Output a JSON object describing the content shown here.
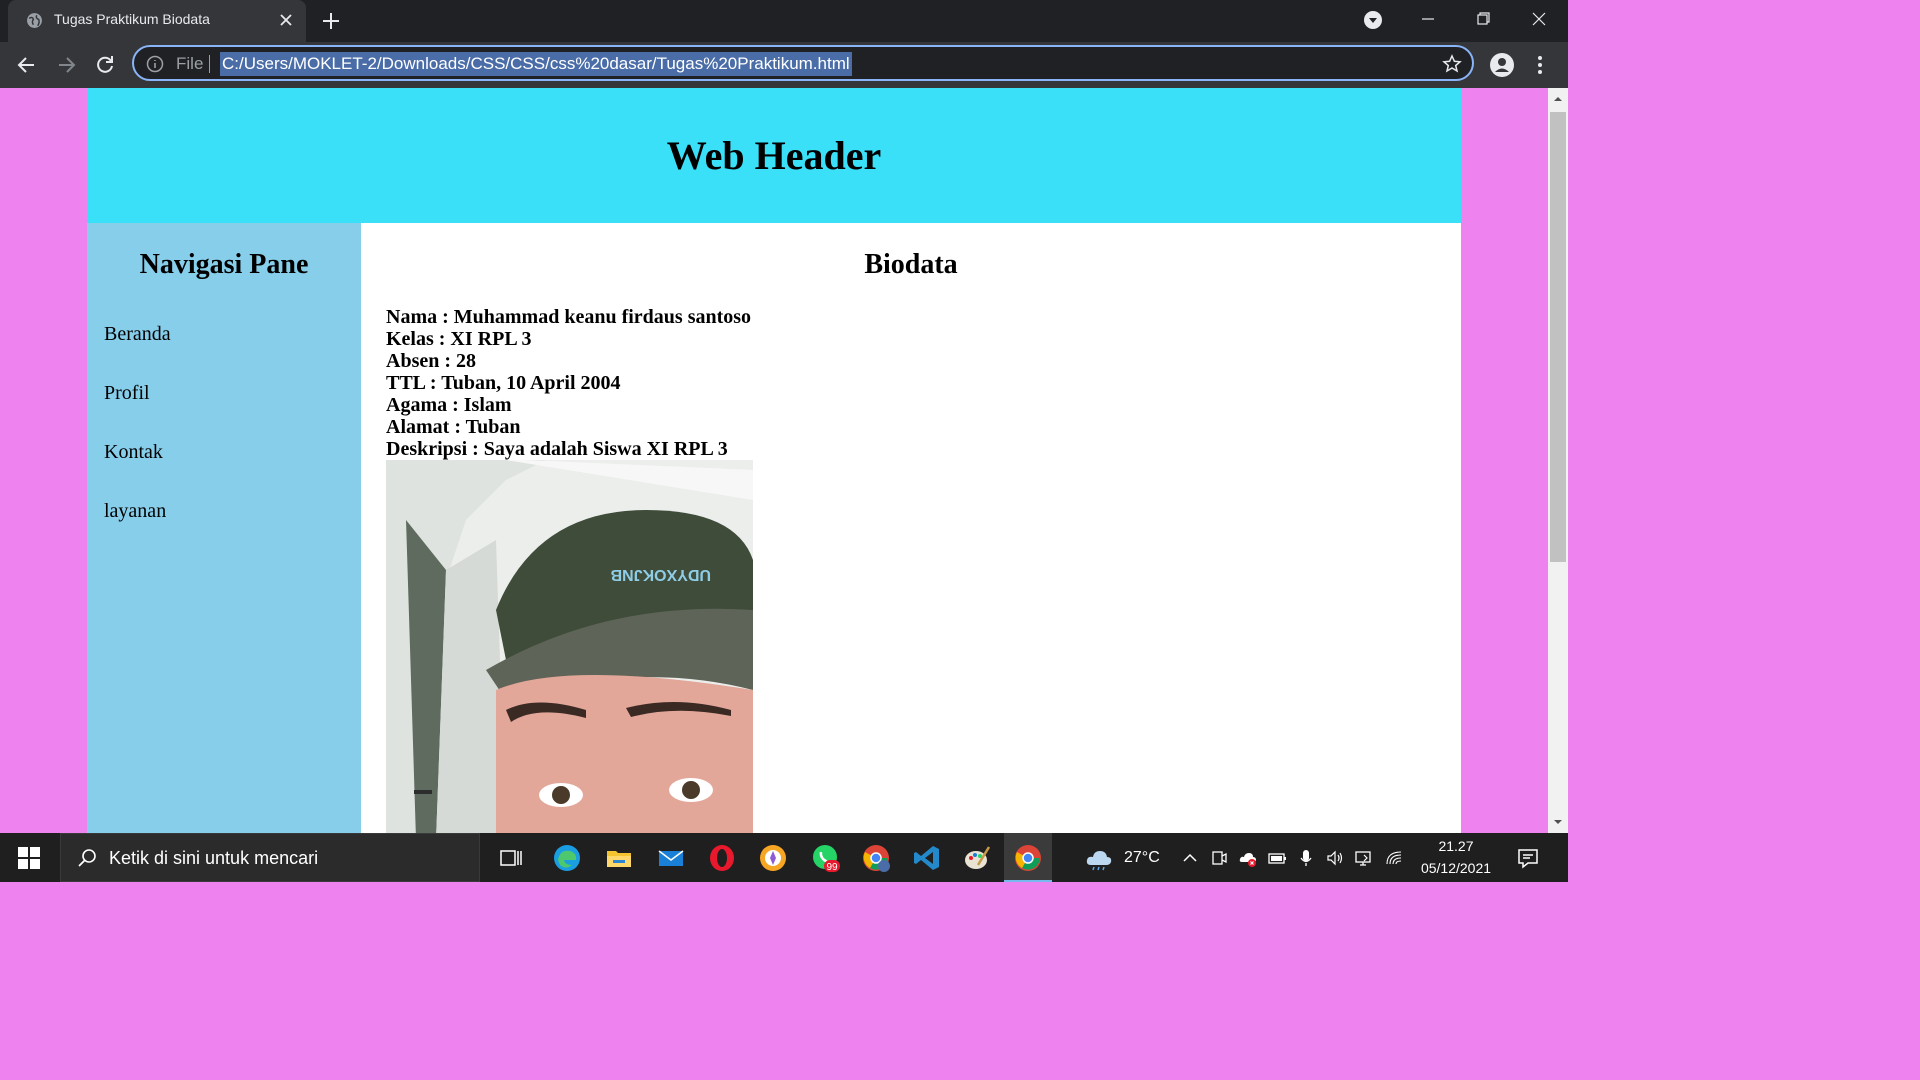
{
  "browser": {
    "tab_title": "Tugas Praktikum Biodata",
    "url_scheme": "File",
    "url": "C:/Users/MOKLET-2/Downloads/CSS/CSS/css%20dasar/Tugas%20Praktikum.html"
  },
  "page": {
    "header_title": "Web Header",
    "sidebar": {
      "title": "Navigasi Pane",
      "items": [
        "Beranda",
        "Profil",
        "Kontak",
        "layanan"
      ]
    },
    "content": {
      "title": "Biodata",
      "lines": [
        "Nama : Muhammad keanu firdaus santoso",
        "Kelas : XI RPL 3",
        "Absen : 28",
        "TTL : Tuban, 10 April 2004",
        "Agama : Islam",
        "Alamat : Tuban",
        "Deskripsi : Saya adalah Siswa XI RPL 3"
      ],
      "photo_text": "UDYXOKJNB"
    },
    "colors": {
      "page_background": "#ee82ee",
      "header": "#3adff8",
      "sidebar": "#87ceeb",
      "content": "#ffffff"
    }
  },
  "taskbar": {
    "search_placeholder": "Ketik di sini untuk mencari",
    "whatsapp_badge": "99",
    "weather_temp": "27°C",
    "time": "21.27",
    "date": "05/12/2021"
  }
}
